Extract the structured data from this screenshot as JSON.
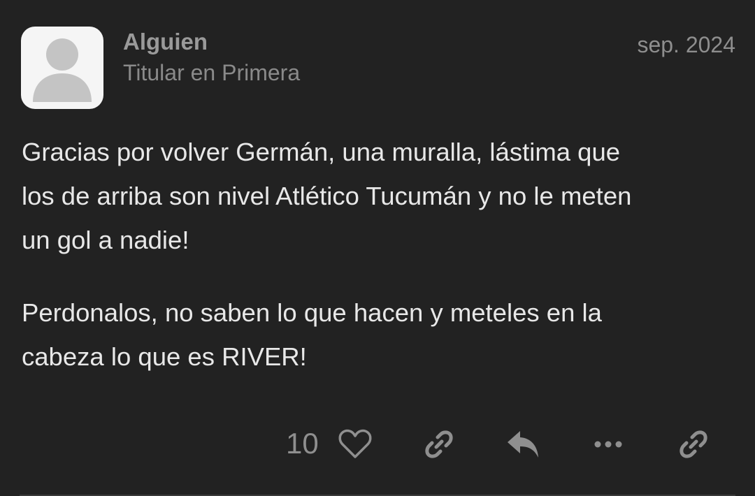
{
  "post": {
    "author": {
      "name": "Alguien",
      "title": "Titular en Primera",
      "avatar_icon": "default-avatar-icon"
    },
    "date": "sep. 2024",
    "body": {
      "paragraphs": [
        "Gracias por volver Germán, una muralla, lástima que\nlos de arriba son nivel Atlético Tucumán y no le meten\nun gol a nadie!",
        "Perdonalos, no saben lo que hacen y meteles en la\ncabeza lo que es RIVER!"
      ]
    },
    "actions": {
      "like_count": "10",
      "like_icon": "heart-icon",
      "copy_link_icon": "link-icon",
      "reply_icon": "reply-icon",
      "more_icon": "more-icon",
      "share_icon": "link-icon"
    }
  },
  "colors": {
    "background": "#222222",
    "text": "#e8e8e8",
    "muted": "#8f8f8f"
  }
}
